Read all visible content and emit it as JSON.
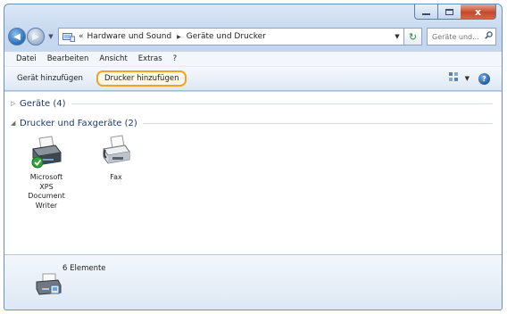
{
  "window": {
    "caption_close_glyph": "x"
  },
  "address": {
    "overflow_marker": "«",
    "crumbs": [
      "Hardware und Sound",
      "Geräte und Drucker"
    ],
    "search_placeholder": "Geräte und... "
  },
  "menubar": {
    "items": [
      "Datei",
      "Bearbeiten",
      "Ansicht",
      "Extras",
      "?"
    ]
  },
  "commandbar": {
    "add_device": "Gerät hinzufügen",
    "add_printer": "Drucker hinzufügen",
    "highlight_color": "#f2a227"
  },
  "groups": [
    {
      "label": "Geräte (4)",
      "expanded": false
    },
    {
      "label": "Drucker und Faxgeräte (2)",
      "expanded": true
    }
  ],
  "devices": [
    {
      "label_lines": [
        "Microsoft",
        "XPS",
        "Document",
        "Writer"
      ],
      "icon": "printer-default-icon"
    },
    {
      "label_lines": [
        "Fax"
      ],
      "icon": "fax-icon"
    }
  ],
  "details": {
    "count": "6 Elemente",
    "icon": "devices-printers-icon"
  }
}
